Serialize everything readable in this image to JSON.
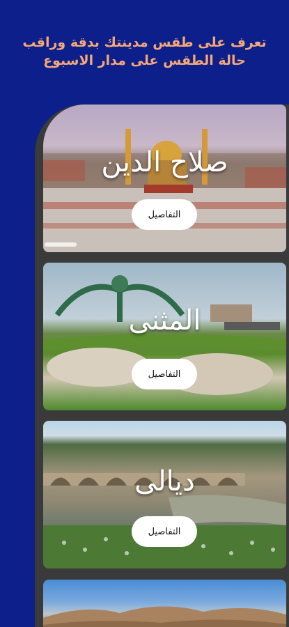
{
  "header": {
    "line1": "تعرف على طقس مدينتك بدقة وراقب",
    "line2": "حالة الطقس على مدار الاسبوع"
  },
  "cities": [
    {
      "name": "صلاح الدين",
      "button_label": "التفاصيل"
    },
    {
      "name": "المثنى",
      "button_label": "التفاصيل"
    },
    {
      "name": "ديالى",
      "button_label": "التفاصيل"
    }
  ],
  "colors": {
    "background": "#0d1f8a",
    "headline": "#f5a878",
    "panel": "#3a3a3a",
    "button": "#ffffff"
  }
}
